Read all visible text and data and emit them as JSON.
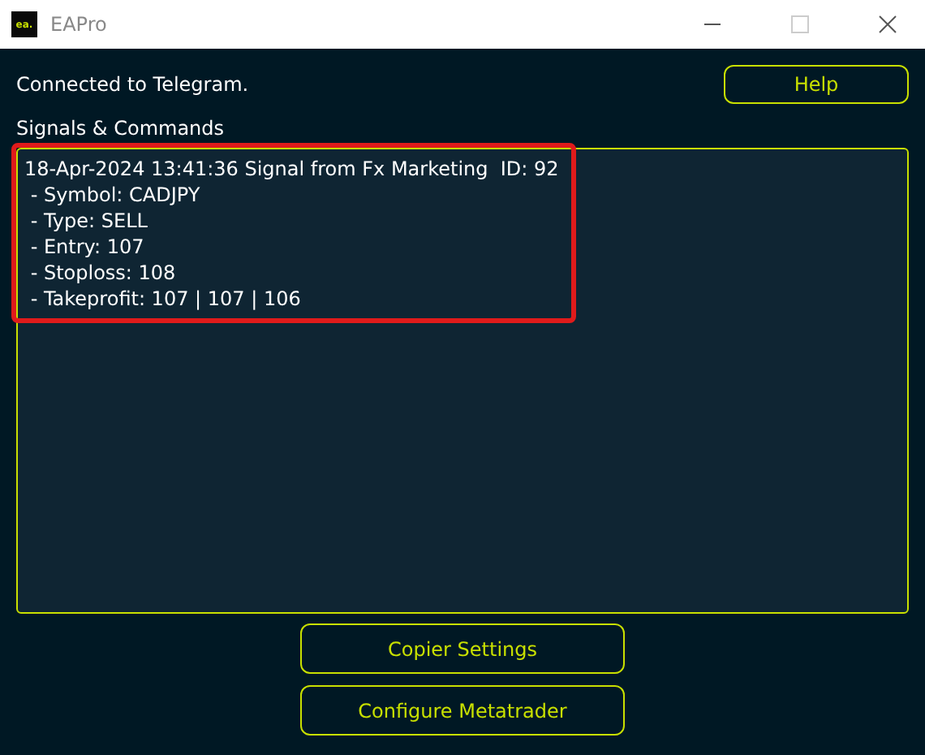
{
  "window": {
    "title": "EAPro",
    "logo": "ea."
  },
  "status": "Connected to Telegram.",
  "help_button": "Help",
  "log": {
    "label": "Signals & Commands",
    "highlighted": true,
    "lines": [
      "18-Apr-2024 13:41:36 Signal from Fx Marketing  ID: 92",
      " - Symbol: CADJPY",
      " - Type: SELL",
      " - Entry: 107",
      " - Stoploss: 108",
      " - Takeprofit: 107 | 107 | 106"
    ]
  },
  "buttons": [
    "Copier Settings",
    "Configure Metatrader"
  ]
}
